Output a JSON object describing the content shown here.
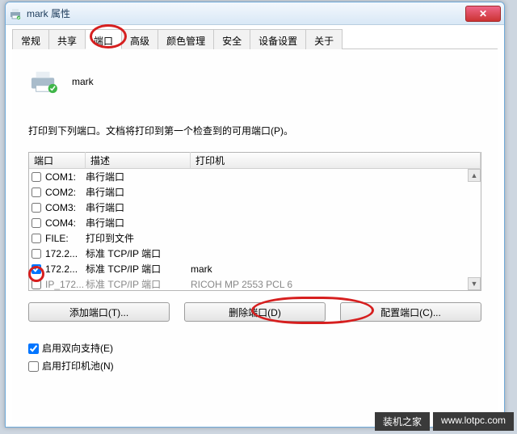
{
  "window": {
    "title": "mark 属性",
    "close": "✕"
  },
  "tabs": [
    "常规",
    "共享",
    "端口",
    "高级",
    "颜色管理",
    "安全",
    "设备设置",
    "关于"
  ],
  "active_tab_index": 2,
  "printer_name": "mark",
  "instruction": "打印到下列端口。文档将打印到第一个检查到的可用端口(P)。",
  "columns": {
    "port": "端口",
    "desc": "描述",
    "printer": "打印机"
  },
  "ports": [
    {
      "checked": false,
      "port": "COM1:",
      "desc": "串行端口",
      "printer": ""
    },
    {
      "checked": false,
      "port": "COM2:",
      "desc": "串行端口",
      "printer": ""
    },
    {
      "checked": false,
      "port": "COM3:",
      "desc": "串行端口",
      "printer": ""
    },
    {
      "checked": false,
      "port": "COM4:",
      "desc": "串行端口",
      "printer": ""
    },
    {
      "checked": false,
      "port": "FILE:",
      "desc": "打印到文件",
      "printer": ""
    },
    {
      "checked": false,
      "port": "172.2...",
      "desc": "标准 TCP/IP 端口",
      "printer": ""
    },
    {
      "checked": true,
      "port": "172.2...",
      "desc": "标准 TCP/IP 端口",
      "printer": "mark"
    },
    {
      "checked": false,
      "port": "IP_172...",
      "desc": "标准 TCP/IP 端口",
      "printer": "RICOH MP 2553 PCL 6"
    }
  ],
  "buttons": {
    "add": "添加端口(T)...",
    "delete": "删除端口(D)",
    "config": "配置端口(C)..."
  },
  "options": {
    "bidir": {
      "checked": true,
      "label": "启用双向支持(E)"
    },
    "pool": {
      "checked": false,
      "label": "启用打印机池(N)"
    }
  },
  "watermark": {
    "a": "装机之家",
    "b": "www.lotpc.com"
  }
}
